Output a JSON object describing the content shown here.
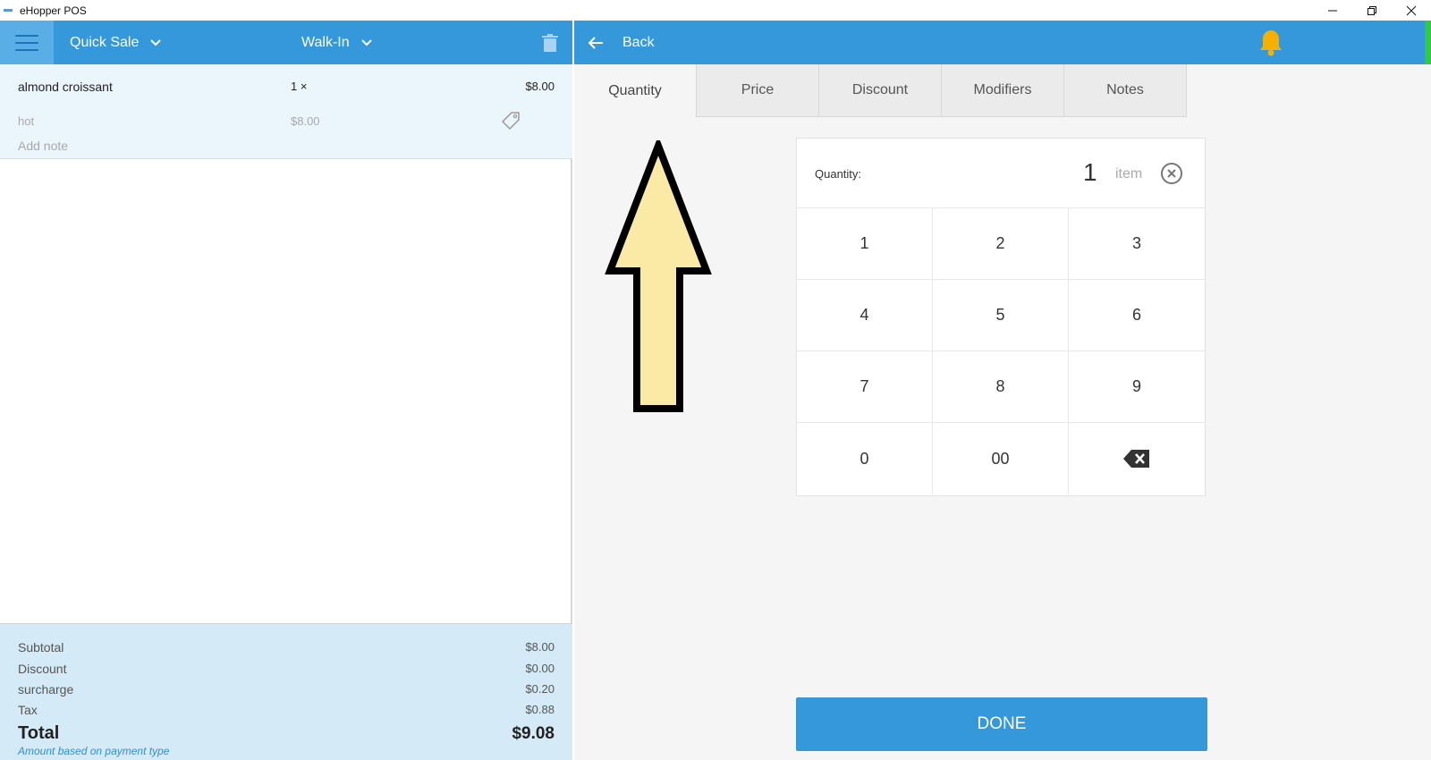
{
  "window": {
    "title": "eHopper POS",
    "controls": [
      "minimize-icon",
      "restore-icon",
      "close-icon"
    ]
  },
  "left_header": {
    "menu_icon": "hamburger-menu-icon",
    "sale_type": "Quick Sale",
    "customer": "Walk-In",
    "delete_icon": "trash-icon",
    "brand_color": "#3498db"
  },
  "order": {
    "items": [
      {
        "name": "almond croissant",
        "qty": "1 ×",
        "price": "$8.00",
        "modifier": "hot",
        "modifier_price": "$8.00",
        "note_placeholder": "Add note"
      }
    ]
  },
  "totals": {
    "subtotal_label": "Subtotal",
    "subtotal": "$8.00",
    "discount_label": "Discount",
    "discount": "$0.00",
    "surcharge_label": "surcharge",
    "surcharge": "$0.20",
    "tax_label": "Tax",
    "tax": "$0.88",
    "total_label": "Total",
    "total": "$9.08",
    "note": "Amount based on payment type"
  },
  "right_header": {
    "back_label": "Back",
    "notification_icon": "bell-icon",
    "bell_color": "#f5b000"
  },
  "tabs": [
    {
      "label": "Quantity",
      "active": true
    },
    {
      "label": "Price",
      "active": false
    },
    {
      "label": "Discount",
      "active": false
    },
    {
      "label": "Modifiers",
      "active": false
    },
    {
      "label": "Notes",
      "active": false
    }
  ],
  "quantity": {
    "label": "Quantity:",
    "value": "1",
    "unit": "item"
  },
  "keypad": {
    "keys": [
      "1",
      "2",
      "3",
      "4",
      "5",
      "6",
      "7",
      "8",
      "9",
      "0",
      "00"
    ],
    "backspace_icon": "backspace-icon"
  },
  "done_label": "DONE",
  "annotation": {
    "arrow_icon": "arrow-up-icon",
    "arrow_fill": "#fbe9a6"
  }
}
